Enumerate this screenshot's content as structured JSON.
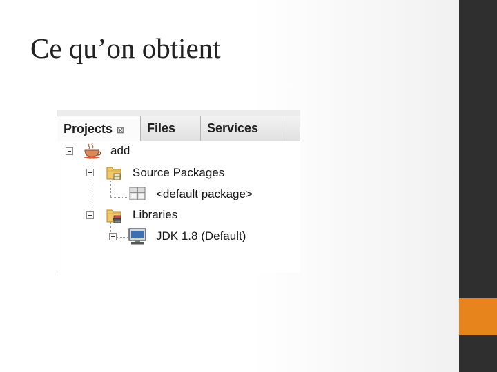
{
  "slide": {
    "title": "Ce qu’on obtient"
  },
  "panel": {
    "tabs": [
      {
        "label": "Projects",
        "active": true,
        "close_glyph": "⊠"
      },
      {
        "label": "Files",
        "active": false
      },
      {
        "label": "Services",
        "active": false
      }
    ],
    "tree": {
      "project": {
        "label": "add",
        "icon": "coffee-cup-icon",
        "expanded": true
      },
      "source_packages": {
        "label": "Source Packages",
        "icon": "package-folder-icon",
        "expanded": true
      },
      "default_package": {
        "label": "<default package>",
        "icon": "package-icon"
      },
      "libraries": {
        "label": "Libraries",
        "icon": "library-folder-icon",
        "expanded": true
      },
      "jdk": {
        "label": "JDK 1.8 (Default)",
        "icon": "jdk-platform-icon",
        "expanded": false
      }
    }
  },
  "colors": {
    "side_bar": "#2f2f2f",
    "accent": "#e8841c",
    "title_text": "#222222"
  }
}
